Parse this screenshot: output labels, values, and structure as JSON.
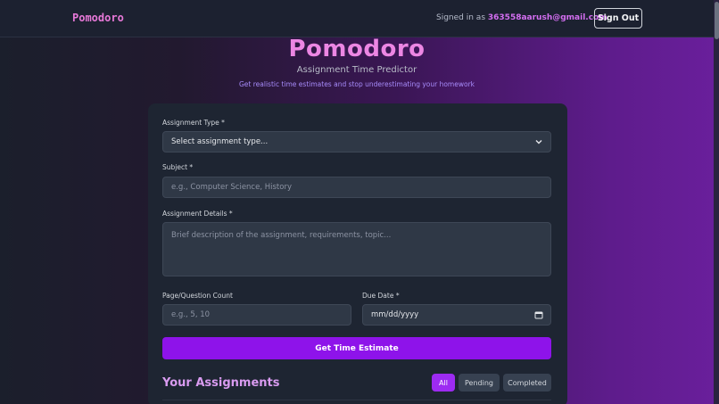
{
  "nav": {
    "brand": "Pomodoro",
    "signed_in_prefix": "Signed in as",
    "email": "363558aarush@gmail.com",
    "sign_out_label": "Sign Out"
  },
  "hero": {
    "title": "Pomodoro",
    "subtitle": "Assignment Time Predictor",
    "tagline": "Get realistic time estimates and stop underestimating your homework"
  },
  "form": {
    "assignment_type": {
      "label": "Assignment Type *",
      "value": "Select assignment type..."
    },
    "subject": {
      "label": "Subject *",
      "placeholder": "e.g., Computer Science, History"
    },
    "details": {
      "label": "Assignment Details *",
      "placeholder": "Brief description of the assignment, requirements, topic..."
    },
    "count": {
      "label": "Page/Question Count",
      "placeholder": "e.g., 5, 10"
    },
    "due_date": {
      "label": "Due Date *",
      "value": "mm/dd/yyyy"
    },
    "submit_label": "Get Time Estimate"
  },
  "assignments": {
    "title": "Your Assignments",
    "filters": [
      {
        "label": "All",
        "active": true
      },
      {
        "label": "Pending",
        "active": false
      },
      {
        "label": "Completed",
        "active": false
      }
    ]
  },
  "colors": {
    "accent": "#8e13ea",
    "brand_pink": "#ec86e3",
    "email": "#d36ef0"
  },
  "icons": [
    "chevron-down-icon",
    "calendar-icon"
  ]
}
